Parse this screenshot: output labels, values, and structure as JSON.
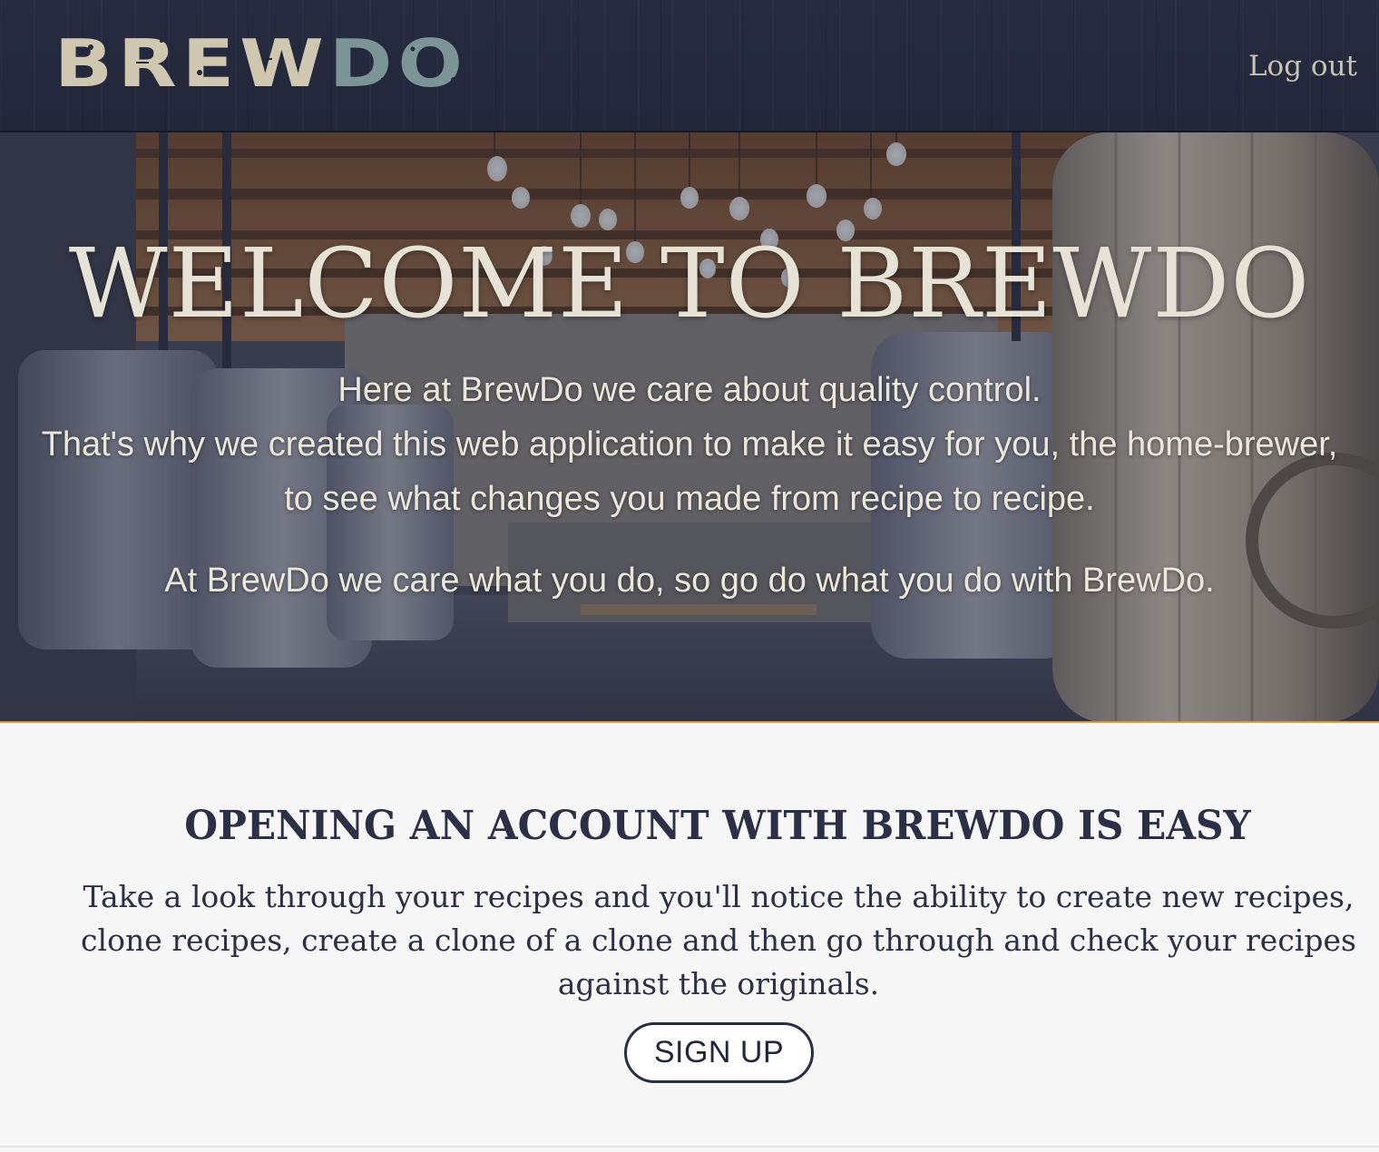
{
  "header": {
    "logo": {
      "part_a": "BREW",
      "part_b": "DO"
    },
    "logout_label": "Log out"
  },
  "hero": {
    "title": "WELCOME TO BREWDO",
    "line_1": "Here at BrewDo we care about quality control.",
    "line_2": "That's why we created this web application to make it easy for you, the home-brewer, to see what changes you made from recipe to recipe.",
    "line_3": "At BrewDo we care what you do, so go do what you do with BrewDo."
  },
  "info": {
    "heading": "OPENING AN ACCOUNT WITH BREWDO IS EASY",
    "body": "Take a look through your recipes and you'll notice the ability to create new recipes, clone recipes, create a clone of a clone and then go through and check your recipes against the originals.",
    "signup_label": "SIGN UP"
  },
  "colors": {
    "header_bg": "#23283b",
    "logo_cream": "#cfc7b0",
    "logo_teal": "#7b9496",
    "text_dark": "#2c3046",
    "hero_accent_border": "#d99a3c",
    "page_bg": "#f6f6f6"
  }
}
